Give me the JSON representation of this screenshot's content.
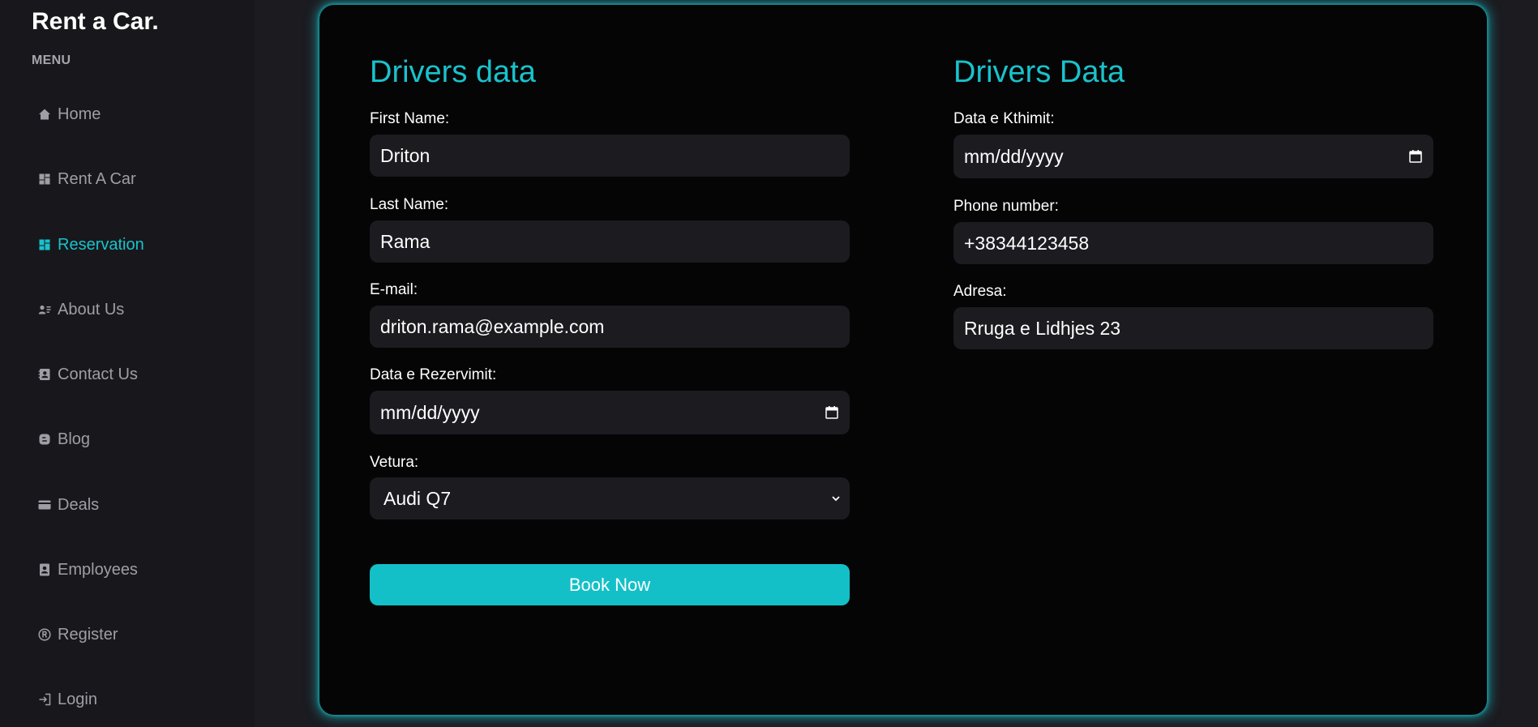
{
  "brand": "Rent a Car.",
  "menu_label": "MENU",
  "sidebar": {
    "items": [
      {
        "label": "Home",
        "icon": "home-icon"
      },
      {
        "label": "Rent A Car",
        "icon": "dashboard-icon"
      },
      {
        "label": "Reservation",
        "icon": "dashboard-icon",
        "active": true
      },
      {
        "label": "About Us",
        "icon": "contact-list-icon"
      },
      {
        "label": "Contact Us",
        "icon": "contact-card-icon"
      },
      {
        "label": "Blog",
        "icon": "blog-icon"
      },
      {
        "label": "Deals",
        "icon": "credit-card-icon"
      },
      {
        "label": "Employees",
        "icon": "badge-icon"
      },
      {
        "label": "Register",
        "icon": "registered-icon"
      },
      {
        "label": "Login",
        "icon": "login-icon"
      }
    ]
  },
  "form": {
    "left_title": "Drivers data",
    "right_title": "Drivers Data",
    "first_name": {
      "label": "First Name:",
      "value": "Driton"
    },
    "last_name": {
      "label": "Last Name:",
      "value": "Rama"
    },
    "email": {
      "label": "E-mail:",
      "value": "driton.rama@example.com"
    },
    "reservation_date": {
      "label": "Data e Rezervimit:",
      "placeholder": "mm/dd/yyyy"
    },
    "car": {
      "label": "Vetura:",
      "value": "Audi Q7"
    },
    "return_date": {
      "label": "Data e Kthimit:",
      "placeholder": "mm/dd/yyyy"
    },
    "phone": {
      "label": "Phone number:",
      "value": "+38344123458"
    },
    "address": {
      "label": "Adresa:",
      "value": "Rruga e Lidhjes 23"
    },
    "submit_label": "Book Now"
  },
  "colors": {
    "accent": "#19c2cc",
    "background": "#1b1b20",
    "card": "#050506",
    "sidebar": "#18181c",
    "input": "#1b1b20"
  }
}
